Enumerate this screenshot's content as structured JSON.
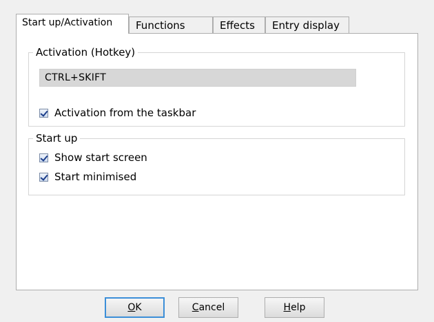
{
  "tabs": [
    {
      "label": "Start up/Activation",
      "active": true
    },
    {
      "label": "Functions",
      "active": false
    },
    {
      "label": "Effects",
      "active": false
    },
    {
      "label": "Entry display",
      "active": false
    }
  ],
  "activation_group": {
    "title": "Activation (Hotkey)",
    "hotkey_value": "CTRL+SKIFT",
    "taskbar_checkbox": {
      "label": "Activation from the taskbar",
      "checked": true
    }
  },
  "startup_group": {
    "title": "Start up",
    "show_start_screen": {
      "label": "Show start screen",
      "checked": true
    },
    "start_minimised": {
      "label": "Start minimised",
      "checked": true
    }
  },
  "buttons": {
    "ok": {
      "mnemonic": "O",
      "rest": "K"
    },
    "cancel": {
      "mnemonic": "C",
      "rest": "ancel"
    },
    "help": {
      "mnemonic": "H",
      "rest": "elp"
    }
  },
  "colors": {
    "window_bg": "#f0f0f0",
    "panel_bg": "#ffffff",
    "hotkey_field_bg": "#d7d7d7",
    "default_button_border": "#3b8ed8"
  }
}
